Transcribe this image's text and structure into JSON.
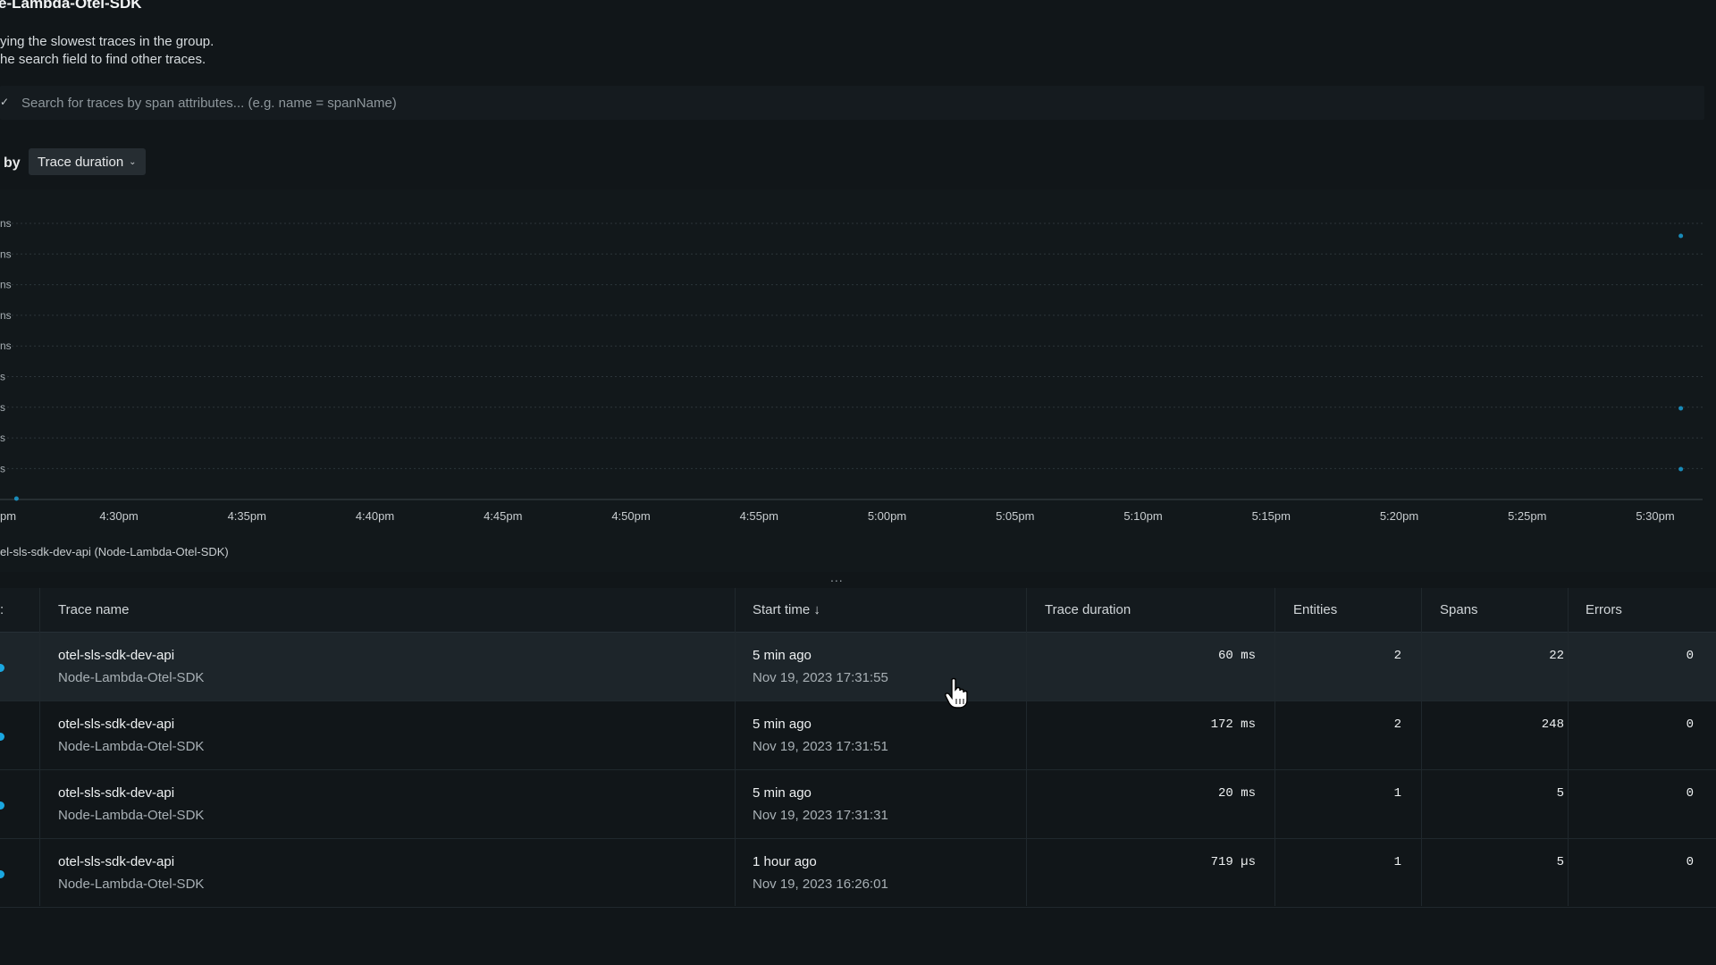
{
  "header": {
    "title": "e-Lambda-Otel-SDK",
    "subtitle_line1": "ying the slowest traces in the group.",
    "subtitle_line2": "he search field to find other traces."
  },
  "search": {
    "placeholder": "Search for traces by span attributes... (e.g. name = spanName)"
  },
  "group_by": {
    "label": "by",
    "selected": "Trace duration"
  },
  "chart_data": {
    "type": "scatter",
    "title": "",
    "xlabel": "",
    "ylabel": "",
    "x_ticks": [
      "4:30pm",
      "4:35pm",
      "4:40pm",
      "4:45pm",
      "4:50pm",
      "4:55pm",
      "5:00pm",
      "5:05pm",
      "5:10pm",
      "5:15pm",
      "5:20pm",
      "5:25pm",
      "5:30pm"
    ],
    "x_tick_first_partial": "pm",
    "y_ticks_partial": [
      "ns",
      "ns",
      "ns",
      "ns",
      "ns",
      "s",
      "s",
      "s",
      "s"
    ],
    "grid": "horizontal dashed",
    "series": [
      {
        "name": "el-sls-sdk-dev-api (Node-Lambda-Otel-SDK)",
        "color": "#1aa7e0"
      }
    ],
    "points": [
      {
        "time": "4:26pm",
        "level": "lowest"
      },
      {
        "time": "5:31pm",
        "level": "high"
      },
      {
        "time": "5:31pm",
        "level": "mid"
      },
      {
        "time": "5:31pm",
        "level": "low"
      }
    ]
  },
  "table": {
    "columns": {
      "trace_name": "Trace name",
      "start_time": "Start time ↓",
      "trace_duration": "Trace duration",
      "entities": "Entities",
      "spans": "Spans",
      "errors": "Errors"
    },
    "rows": [
      {
        "name": "otel-sls-sdk-dev-api",
        "group": "Node-Lambda-Otel-SDK",
        "ago": "5 min ago",
        "date": "Nov 19, 2023 17:31:55",
        "duration": "60 ms",
        "entities": "2",
        "spans": "22",
        "errors": "0"
      },
      {
        "name": "otel-sls-sdk-dev-api",
        "group": "Node-Lambda-Otel-SDK",
        "ago": "5 min ago",
        "date": "Nov 19, 2023 17:31:51",
        "duration": "172 ms",
        "entities": "2",
        "spans": "248",
        "errors": "0"
      },
      {
        "name": "otel-sls-sdk-dev-api",
        "group": "Node-Lambda-Otel-SDK",
        "ago": "5 min ago",
        "date": "Nov 19, 2023 17:31:31",
        "duration": "20 ms",
        "entities": "1",
        "spans": "5",
        "errors": "0"
      },
      {
        "name": "otel-sls-sdk-dev-api",
        "group": "Node-Lambda-Otel-SDK",
        "ago": "1 hour ago",
        "date": "Nov 19, 2023 16:26:01",
        "duration": "719 µs",
        "entities": "1",
        "spans": "5",
        "errors": "0"
      }
    ]
  },
  "drag_handle": "..."
}
